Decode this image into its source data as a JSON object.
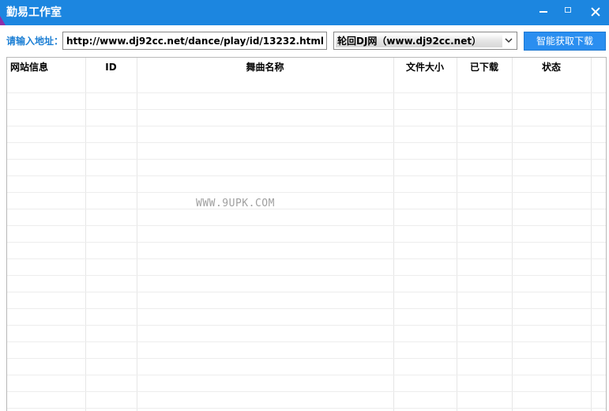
{
  "window": {
    "title": "勤易工作室",
    "titlebar_color": "#1c86e0",
    "controls": [
      "minimize-icon",
      "maximize-icon",
      "close-icon"
    ]
  },
  "toolbar": {
    "url_label": "请输入地址：",
    "url_value": "http://www.dj92cc.net/dance/play/id/13232.html",
    "site_selected": "轮回DJ网（www.dj92cc.net）",
    "action_label": "智能获取下载",
    "accent_color": "#2a8ef0"
  },
  "table": {
    "columns": [
      "网站信息",
      "ID",
      "舞曲名称",
      "文件大小",
      "已下载",
      "状态"
    ],
    "rows": []
  },
  "watermark": "WWW.9UPK.COM"
}
